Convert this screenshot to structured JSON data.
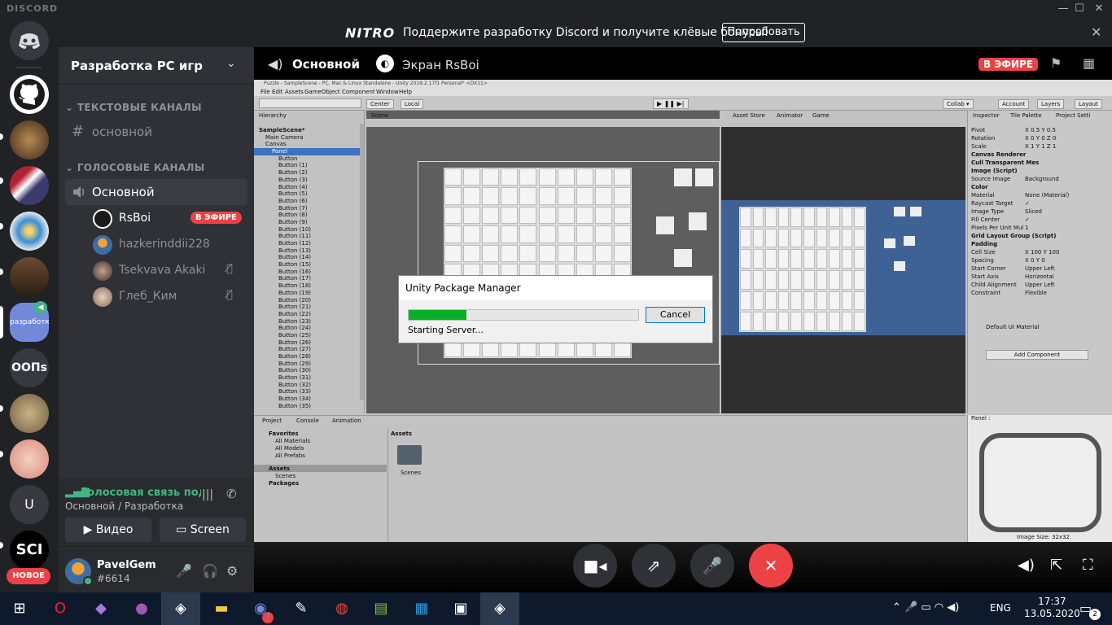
{
  "window": {
    "wordmark": "DISCORD",
    "minimize": "—",
    "maximize": "☐",
    "close": "✕"
  },
  "nitro": {
    "logo": "NITRO",
    "message": "Поддержите разработку Discord и получите клёвые бонусы!",
    "button": "Попробовать",
    "close": "✕"
  },
  "guilds": {
    "oop_label": "ООПs",
    "u_label": "U",
    "sci_label": "SCI",
    "new_badge": "НОВОЕ",
    "server_short": "разработкаР"
  },
  "server": {
    "name": "Разработка РС игр",
    "chevron": "⌄"
  },
  "categories": {
    "text": "ТЕКСТОВЫЕ КАНАЛЫ",
    "voice": "ГОЛОСОВЫЕ КАНАЛЫ"
  },
  "text_channels": [
    {
      "name": "основной"
    }
  ],
  "voice_channels": [
    {
      "name": "Основной"
    }
  ],
  "voice_users": [
    {
      "name": "RsBoi",
      "badge": "В ЭФИРЕ"
    },
    {
      "name": "hazkerinddii228"
    },
    {
      "name": "Tsekvava Akaki"
    },
    {
      "name": "Глеб_Ким"
    }
  ],
  "voice_panel": {
    "status": "Голосовая связь подключена",
    "sub": "Основной / Разработка РС игр",
    "video_button": "Видео",
    "screen_button": "Screen"
  },
  "user": {
    "name": "PavelGem",
    "tag": "#6614"
  },
  "stream": {
    "channel": "Основной",
    "screen": "Экран RsBoi",
    "live": "В ЭФИРЕ"
  },
  "unity": {
    "title": "Puzzle - SampleScene - PC, Mac & Linux Standalone - Unity 2019.2.17f1 Personal* <DX11>",
    "menu": [
      "File",
      "Edit",
      "Assets",
      "GameObject",
      "Component",
      "Window",
      "Help"
    ],
    "toolbar": {
      "center": "Center",
      "local": "Local",
      "collab": "Collab ▾",
      "account": "Account",
      "layers": "Layers",
      "layout": "Layout"
    },
    "hierarchy_title": "Hierarchy",
    "hierarchy": [
      "SampleScene*",
      "Main Camera",
      "Canvas",
      "Panel",
      "Button",
      "Button (1)",
      "Button (2)",
      "Button (3)",
      "Button (4)",
      "Button (5)",
      "Button (6)",
      "Button (7)",
      "Button (8)",
      "Button (9)",
      "Button (10)",
      "Button (11)",
      "Button (12)",
      "Button (13)",
      "Button (14)",
      "Button (15)",
      "Button (16)",
      "Button (17)",
      "Button (18)",
      "Button (19)",
      "Button (20)",
      "Button (21)",
      "Button (22)",
      "Button (23)",
      "Button (24)",
      "Button (25)",
      "Button (26)",
      "Button (27)",
      "Button (28)",
      "Button (29)",
      "Button (30)",
      "Button (31)",
      "Button (32)",
      "Button (33)",
      "Button (34)",
      "Button (35)"
    ],
    "scene_tab": "Scene",
    "game_tabs": [
      "Asset Store",
      "Animator",
      "Game"
    ],
    "inspector_tabs": [
      "Inspector",
      "Tile Palette",
      "Project Setti"
    ],
    "inspector": [
      {
        "label": "Pivot",
        "value": "X 0.5   Y 0.5"
      },
      {
        "label": "Rotation",
        "value": "X 0   Y 0   Z 0"
      },
      {
        "label": "Scale",
        "value": "X 1   Y 1   Z 1"
      },
      {
        "label": "Canvas Renderer",
        "value": ""
      },
      {
        "label": "Cull Transparent Mes",
        "value": ""
      },
      {
        "label": "Image (Script)",
        "value": ""
      },
      {
        "label": "Source Image",
        "value": "Background"
      },
      {
        "label": "Color",
        "value": ""
      },
      {
        "label": "Material",
        "value": "None (Material)"
      },
      {
        "label": "Raycast Target",
        "value": "✓"
      },
      {
        "label": "Image Type",
        "value": "Sliced"
      },
      {
        "label": "Fill Center",
        "value": "✓"
      },
      {
        "label": "Pixels Per Unit Mul",
        "value": "1"
      },
      {
        "label": "Grid Layout Group (Script)",
        "value": ""
      },
      {
        "label": "Padding",
        "value": ""
      },
      {
        "label": "Cell Size",
        "value": "X 100   Y 100"
      },
      {
        "label": "Spacing",
        "value": "X 0   Y 0"
      },
      {
        "label": "Start Corner",
        "value": "Upper Left"
      },
      {
        "label": "Start Axis",
        "value": "Horizontal"
      },
      {
        "label": "Child Alignment",
        "value": "Upper Left"
      },
      {
        "label": "Constraint",
        "value": "Flexible"
      }
    ],
    "material": "Default UI Material",
    "add_component": "Add Component",
    "preview_title": "Panel :",
    "image_size": "Image Size: 32x32",
    "project_tabs": [
      "Project",
      "Console",
      "Animation"
    ],
    "favorites": [
      "Favorites",
      "All Materials",
      "All Models",
      "All Prefabs"
    ],
    "assets_tree": [
      "Assets",
      "Scenes",
      "Packages"
    ],
    "assets_header": "Assets",
    "scenes_folder": "Scenes"
  },
  "dialog": {
    "title": "Unity Package Manager",
    "cancel": "Cancel",
    "status": "Starting Server...",
    "progress": 0.25
  },
  "taskbar": {
    "lang": "ENG",
    "time": "17:37",
    "date": "13.05.2020",
    "notify_count": "2",
    "discord_badge": "7"
  }
}
